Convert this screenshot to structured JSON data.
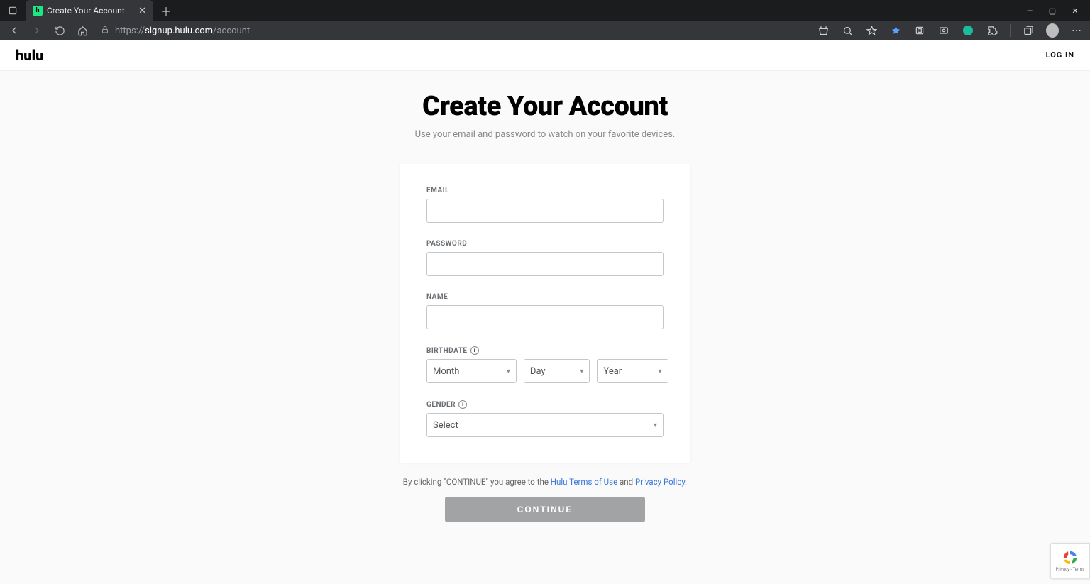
{
  "browser": {
    "tab_title": "Create Your Account",
    "url_host": "signup.hulu.com",
    "url_prefix": "https://",
    "url_path": "/account"
  },
  "header": {
    "logo": "hulu",
    "login": "LOG IN"
  },
  "page": {
    "title": "Create Your Account",
    "subtitle": "Use your email and password to watch on your favorite devices."
  },
  "form": {
    "email_label": "EMAIL",
    "password_label": "PASSWORD",
    "name_label": "NAME",
    "birthdate_label": "BIRTHDATE",
    "gender_label": "GENDER",
    "month_placeholder": "Month",
    "day_placeholder": "Day",
    "year_placeholder": "Year",
    "gender_placeholder": "Select"
  },
  "legal": {
    "prefix": "By clicking \"CONTINUE\" you agree to the ",
    "terms": "Hulu Terms of Use",
    "and": " and ",
    "privacy": "Privacy Policy",
    "suffix": "."
  },
  "cta": {
    "continue": "CONTINUE"
  },
  "recaptcha": {
    "line1": "Privacy - Terms"
  }
}
